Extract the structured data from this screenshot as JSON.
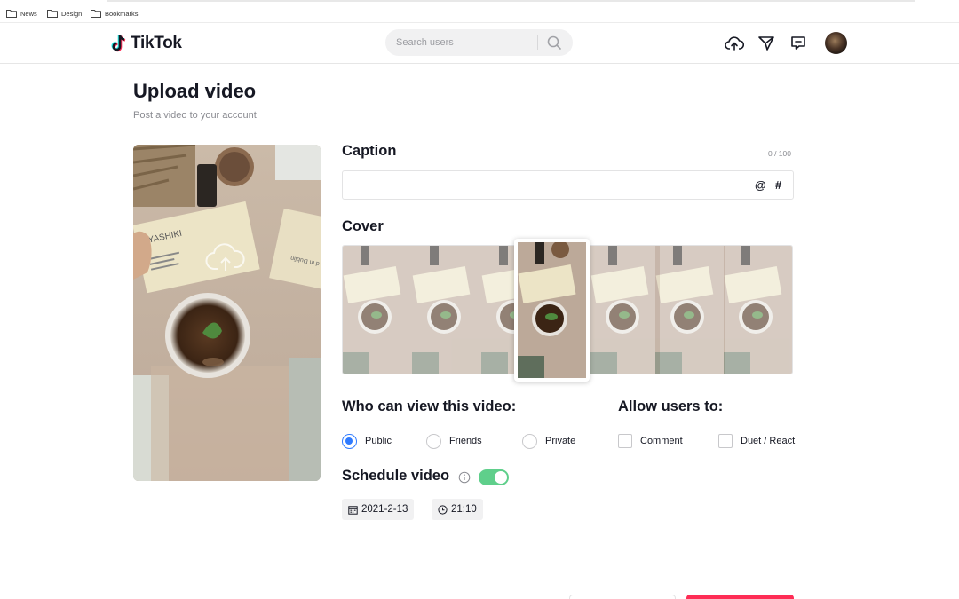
{
  "bookmarks": [
    {
      "label": "News",
      "icon": "folder-icon"
    },
    {
      "label": "Design",
      "icon": "folder-icon"
    },
    {
      "label": "Bookmarks",
      "icon": "folder-icon"
    }
  ],
  "header": {
    "logo_text": "TikTok",
    "search_placeholder": "Search users",
    "icons": [
      "upload-cloud-icon",
      "send-icon",
      "inbox-icon"
    ]
  },
  "page": {
    "title": "Upload video",
    "subtitle": "Post a video to your account"
  },
  "caption": {
    "label": "Caption",
    "counter": "0 / 100",
    "value": "",
    "mention_symbol": "@",
    "hashtag_symbol": "#"
  },
  "cover": {
    "label": "Cover",
    "selected_index": 3
  },
  "privacy": {
    "label": "Who can view this video:",
    "options": [
      "Public",
      "Friends",
      "Private"
    ],
    "selected": "Public"
  },
  "allow": {
    "label": "Allow users to:",
    "options": [
      {
        "label": "Comment",
        "checked": false
      },
      {
        "label": "Duet / React",
        "checked": false
      }
    ]
  },
  "schedule": {
    "label": "Schedule video",
    "enabled": true,
    "date": "2021-2-13",
    "time": "21:10"
  },
  "colors": {
    "accent": "#fe2c55",
    "toggle_on": "#5fcf8b",
    "radio_selected": "#2f7bff"
  }
}
